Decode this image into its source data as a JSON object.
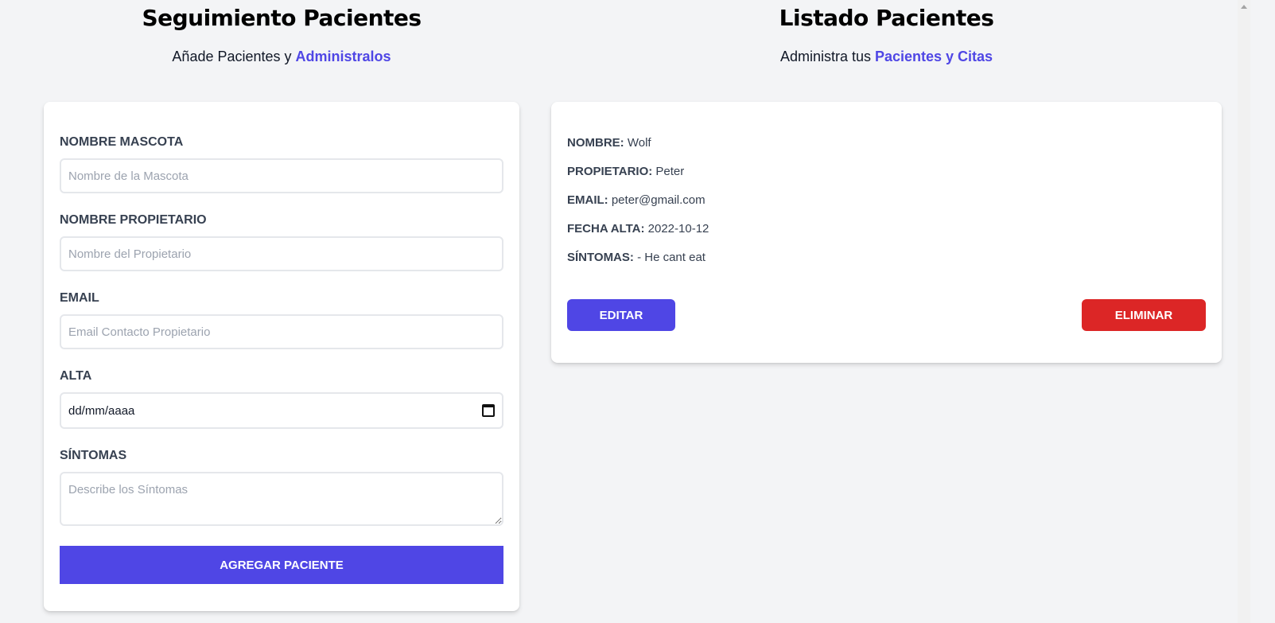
{
  "form_section": {
    "title": "Seguimiento Pacientes",
    "subtitle_prefix": "Añade Pacientes y ",
    "subtitle_accent": "Administralos",
    "fields": {
      "pet_name": {
        "label": "NOMBRE MASCOTA",
        "placeholder": "Nombre de la Mascota"
      },
      "owner_name": {
        "label": "NOMBRE PROPIETARIO",
        "placeholder": "Nombre del Propietario"
      },
      "email": {
        "label": "EMAIL",
        "placeholder": "Email Contacto Propietario"
      },
      "date": {
        "label": "ALTA",
        "value": "dd/mm/aaaa"
      },
      "symptoms": {
        "label": "SÍNTOMAS",
        "placeholder": "Describe los Síntomas"
      }
    },
    "submit_label": "AGREGAR PACIENTE"
  },
  "list_section": {
    "title": "Listado Pacientes",
    "subtitle_prefix": "Administra tus ",
    "subtitle_accent": "Pacientes y Citas",
    "patients": [
      {
        "name_key": "NOMBRE:",
        "name": "Wolf",
        "owner_key": "PROPIETARIO:",
        "owner": "Peter",
        "email_key": "EMAIL:",
        "email": "peter@gmail.com",
        "date_key": "FECHA ALTA:",
        "date": "2022-10-12",
        "symptoms_key": "SÍNTOMAS:",
        "symptoms": "- He cant eat",
        "edit_label": "EDITAR",
        "delete_label": "ELIMINAR"
      }
    ]
  },
  "colors": {
    "accent": "#4f46e5",
    "danger": "#dc2626",
    "background": "#f3f4f6"
  }
}
